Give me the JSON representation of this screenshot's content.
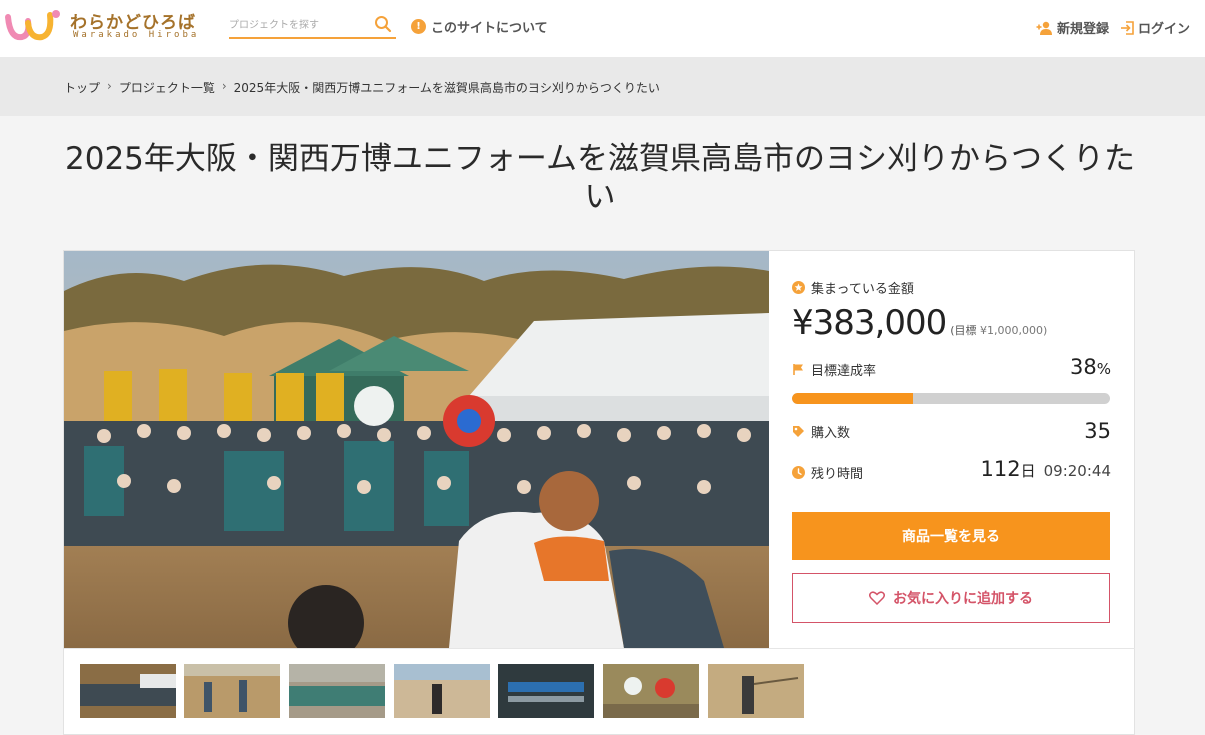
{
  "header": {
    "logo_text": "わらかどひろば",
    "logo_sub": "Warakado Hiroba",
    "search_placeholder": "プロジェクトを探す",
    "about_label": "このサイトについて",
    "register_label": "新規登録",
    "login_label": "ログイン"
  },
  "breadcrumb": {
    "items": [
      "トップ",
      "プロジェクト一覧",
      "2025年大阪・関西万博ユニフォームを滋賀県高島市のヨシ刈りからつくりたい"
    ],
    "separator": "›"
  },
  "project": {
    "title": "2025年大阪・関西万博ユニフォームを滋賀県高島市のヨシ刈りからつくりたい"
  },
  "stats": {
    "raised_label": "集まっている金額",
    "raised_amount": "¥383,000",
    "goal_prefix": "(目標",
    "goal_amount": "¥1,000,000)",
    "achievement_label": "目標達成率",
    "achievement_value": "38",
    "achievement_unit": "%",
    "achievement_fraction": 0.38,
    "purchases_label": "購入数",
    "purchases_value": "35",
    "remaining_label": "残り時間",
    "remaining_days": "112",
    "remaining_days_unit": "日",
    "remaining_time": "09:20:44"
  },
  "actions": {
    "view_products": "商品一覧を見る",
    "add_favorite": "お気に入りに追加する"
  },
  "colors": {
    "accent": "#f7941d",
    "favorite": "#d45468",
    "logo_brown": "#a5722a"
  }
}
